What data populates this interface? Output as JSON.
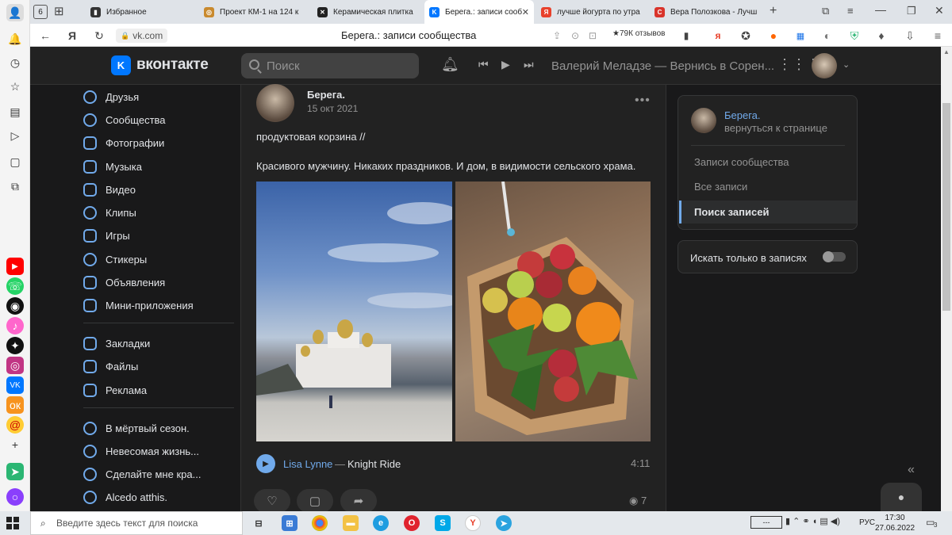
{
  "browser": {
    "tabs": [
      {
        "label": "Избранное",
        "fav_color": "#333333",
        "fav_char": "■"
      },
      {
        "label": "Проект КМ-1 на 124 к",
        "fav_color": "#c98a2e",
        "fav_char": "◎"
      },
      {
        "label": "Керамическая плитка",
        "fav_color": "#222222",
        "fav_char": "✕"
      },
      {
        "label": "Берега.: записи сооб",
        "fav_color": "#0077ff",
        "fav_char": "K"
      },
      {
        "label": "лучше йогурта по утра",
        "fav_color": "#e8412b",
        "fav_char": "Я"
      },
      {
        "label": "Вера Полозкова - Лучш",
        "fav_color": "#d9342b",
        "fav_char": "C"
      }
    ],
    "tab_count_badge": "6",
    "url": "vk.com",
    "page_title": "Берега.: записи сообщества",
    "reviews": "★79К отзывов"
  },
  "vk": {
    "logo_text": "вконтакте",
    "search_placeholder": "Поиск",
    "now_playing": "Валерий Меладзе — Вернись в Сорен..."
  },
  "nav": {
    "main": [
      {
        "label": "Друзья",
        "icon": "friends-icon"
      },
      {
        "label": "Сообщества",
        "icon": "groups-icon"
      },
      {
        "label": "Фотографии",
        "icon": "photos-icon"
      },
      {
        "label": "Музыка",
        "icon": "music-icon"
      },
      {
        "label": "Видео",
        "icon": "video-icon"
      },
      {
        "label": "Клипы",
        "icon": "clips-icon"
      },
      {
        "label": "Игры",
        "icon": "games-icon"
      },
      {
        "label": "Стикеры",
        "icon": "stickers-icon"
      },
      {
        "label": "Объявления",
        "icon": "ads-icon"
      },
      {
        "label": "Мини-приложения",
        "icon": "apps-icon"
      }
    ],
    "secondary": [
      {
        "label": "Закладки",
        "icon": "bookmarks-icon"
      },
      {
        "label": "Файлы",
        "icon": "files-icon"
      },
      {
        "label": "Реклама",
        "icon": "advert-icon"
      }
    ],
    "groups": [
      {
        "label": "В мёртвый сезон.",
        "icon": "group-icon"
      },
      {
        "label": "Невесомая жизнь...",
        "icon": "group-icon"
      },
      {
        "label": "Сделайте мне кра...",
        "icon": "group-icon"
      },
      {
        "label": "Alcedo atthis.",
        "icon": "group-icon"
      }
    ]
  },
  "post": {
    "author": "Берега.",
    "date": "15 окт 2021",
    "text_line1": "продуктовая корзина //",
    "text_line2": "Красивого мужчину. Никаких праздников. И дом, в видимости сельского храма.",
    "audio_artist": "Lisa Lynne",
    "audio_dash": "—",
    "audio_title": "Knight Ride",
    "audio_duration": "4:11",
    "views": "7"
  },
  "right": {
    "community_name": "Берега.",
    "back_link": "вернуться к странице",
    "menu": [
      "Записи сообщества",
      "Все записи",
      "Поиск записей"
    ],
    "filter_label": "Искать только в записях"
  },
  "taskbar": {
    "search_placeholder": "Введите здесь текст для поиска",
    "lang": "РУС",
    "time": "17:30",
    "date": "27.06.2022",
    "notif_count": "3"
  }
}
